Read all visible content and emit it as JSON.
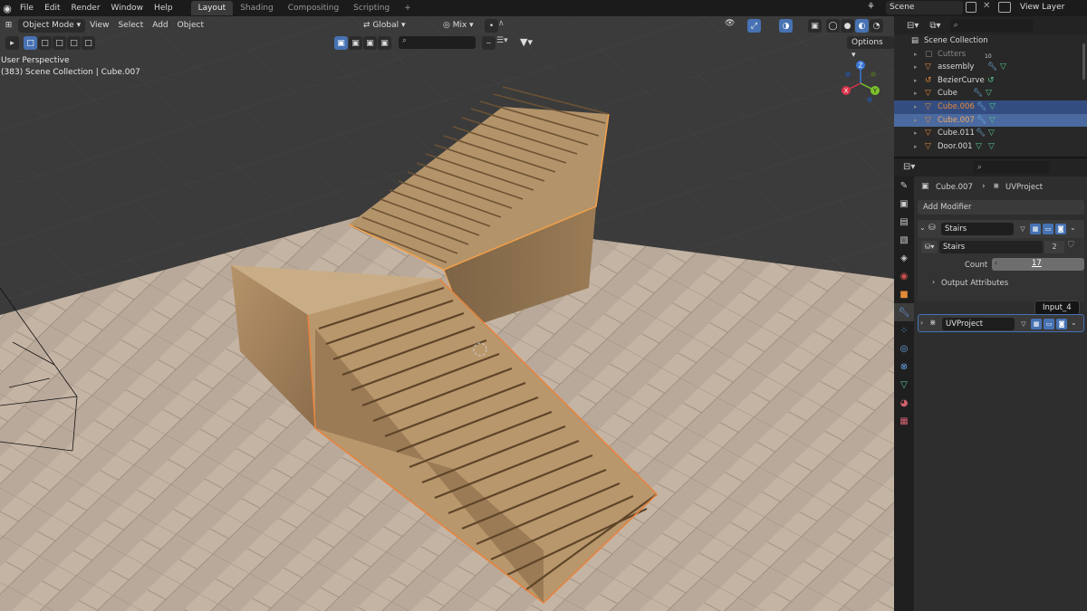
{
  "menubar": {
    "items": [
      "File",
      "Edit",
      "Render",
      "Window",
      "Help"
    ],
    "workspaces": [
      "Layout",
      "Shading",
      "Compositing",
      "Scripting"
    ],
    "active_workspace": "Layout",
    "add_workspace": "+",
    "scene": "Scene",
    "view_layer": "View Layer"
  },
  "viewport": {
    "mode": "Object Mode",
    "menus": [
      "View",
      "Select",
      "Add",
      "Object"
    ],
    "orientation": "Global",
    "pivot": "Mix",
    "options": "Options",
    "perspective_label": "User Perspective",
    "collection_label": "(383) Scene Collection | Cube.007",
    "gizmo_axes": {
      "z": "Z",
      "y": "Y",
      "x": "X"
    }
  },
  "outliner": {
    "root": "Scene Collection",
    "rows": [
      {
        "name": "Cutters",
        "badge": "10",
        "dim": true,
        "selected": false
      },
      {
        "name": "assembly",
        "selected": false
      },
      {
        "name": "BezierCurve",
        "selected": false
      },
      {
        "name": "Cube",
        "selected": false
      },
      {
        "name": "Cube.006",
        "selected": true,
        "active_color": "#e6873c"
      },
      {
        "name": "Cube.007",
        "selected": true,
        "active_color": "#f0a660"
      },
      {
        "name": "Cube.011",
        "selected": false
      },
      {
        "name": "Door.001",
        "selected": false
      }
    ]
  },
  "properties": {
    "breadcrumb_object": "Cube.007",
    "breadcrumb_sep": "›",
    "breadcrumb_modifier": "UVProject",
    "add_modifier": "Add Modifier",
    "modifier1_name": "Stairs",
    "node_group_name": "Stairs",
    "node_group_users": "2",
    "count_label": "Count",
    "count_value": "17",
    "output_attributes": "Output Attributes",
    "tooltip": "Input_4",
    "modifier2_name": "UVProject"
  },
  "colors": {
    "accent_blue": "#4772b3",
    "selection_orange": "#e8823c",
    "active_outline": "#f2a04a"
  }
}
